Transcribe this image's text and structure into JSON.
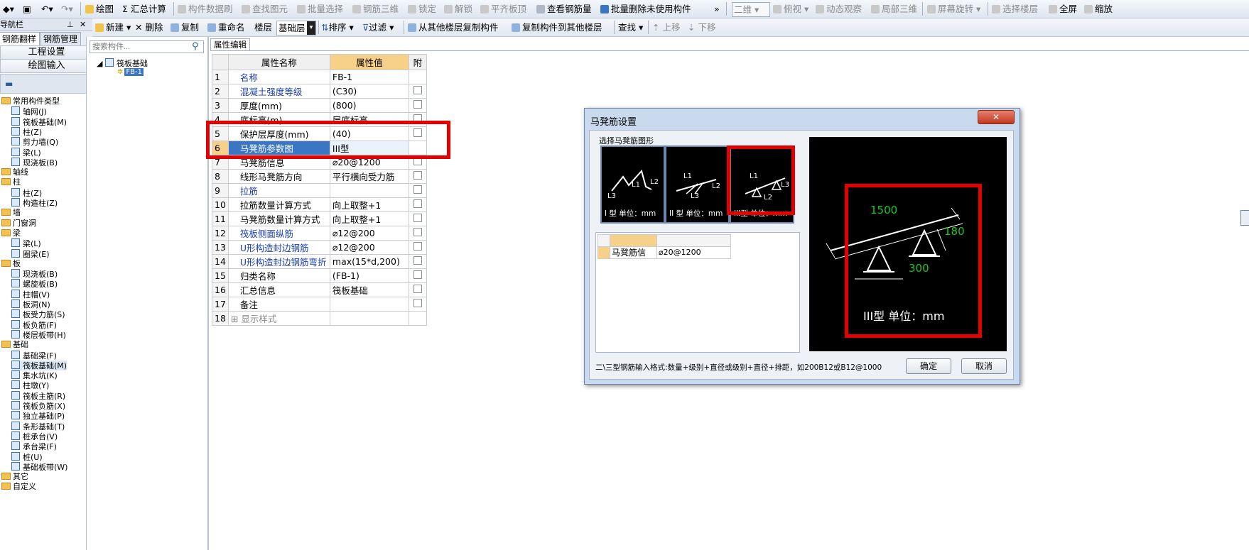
{
  "toolbar": {
    "draw": "绘图",
    "summary": "Σ 汇总计算",
    "brush": "构件数据刷",
    "find_elem": "查找图元",
    "batch_select": "批量选择",
    "rebar_3d": "钢筋三维",
    "lock": "锁定",
    "unlock": "解锁",
    "flat_top": "平齐板顶",
    "view_rebar": "查看钢筋量",
    "batch_delete": "批量删除未使用构件",
    "view_2d": "二维",
    "topview": "俯视",
    "dynamic": "动态观察",
    "local_3d": "局部三维",
    "rotate": "屏幕旋转",
    "select_floor": "选择楼层",
    "fullscreen": "全屏",
    "zoom": "缩放"
  },
  "toolbar2": {
    "new": "新建",
    "delete": "删除",
    "copy": "复制",
    "rename": "重命名",
    "floor_label": "楼层",
    "floor_value": "基础层",
    "sort": "排序",
    "filter": "过滤",
    "copy_from": "从其他楼层复制构件",
    "copy_to": "复制构件到其他楼层",
    "find": "查找",
    "move_up": "上移",
    "move_down": "下移"
  },
  "nav": {
    "header": "导航栏",
    "tab_rebar": "钢筋翻样",
    "tab_manage": "钢筋管理",
    "project_settings": "工程设置",
    "drawing_input": "绘图输入",
    "items": [
      {
        "label": "常用构件类型",
        "folder": true
      },
      {
        "label": "轴网(J)",
        "folder": false
      },
      {
        "label": "筏板基础(M)",
        "folder": false
      },
      {
        "label": "柱(Z)",
        "folder": false
      },
      {
        "label": "剪力墙(Q)",
        "folder": false
      },
      {
        "label": "梁(L)",
        "folder": false
      },
      {
        "label": "现浇板(B)",
        "folder": false
      },
      {
        "label": "轴线",
        "folder": true
      },
      {
        "label": "柱",
        "folder": true
      },
      {
        "label": "柱(Z)",
        "folder": false
      },
      {
        "label": "构造柱(Z)",
        "folder": false
      },
      {
        "label": "墙",
        "folder": true
      },
      {
        "label": "门窗洞",
        "folder": true
      },
      {
        "label": "梁",
        "folder": true
      },
      {
        "label": "梁(L)",
        "folder": false
      },
      {
        "label": "圈梁(E)",
        "folder": false
      },
      {
        "label": "板",
        "folder": true
      },
      {
        "label": "现浇板(B)",
        "folder": false
      },
      {
        "label": "螺旋板(B)",
        "folder": false
      },
      {
        "label": "柱帽(V)",
        "folder": false
      },
      {
        "label": "板洞(N)",
        "folder": false
      },
      {
        "label": "板受力筋(S)",
        "folder": false
      },
      {
        "label": "板负筋(F)",
        "folder": false
      },
      {
        "label": "楼层板带(H)",
        "folder": false
      },
      {
        "label": "基础",
        "folder": true
      },
      {
        "label": "基础梁(F)",
        "folder": false
      },
      {
        "label": "筏板基础(M)",
        "folder": false
      },
      {
        "label": "集水坑(K)",
        "folder": false
      },
      {
        "label": "柱墩(Y)",
        "folder": false
      },
      {
        "label": "筏板主筋(R)",
        "folder": false
      },
      {
        "label": "筏板负筋(X)",
        "folder": false
      },
      {
        "label": "独立基础(P)",
        "folder": false
      },
      {
        "label": "条形基础(T)",
        "folder": false
      },
      {
        "label": "桩承台(V)",
        "folder": false
      },
      {
        "label": "承台梁(F)",
        "folder": false
      },
      {
        "label": "桩(U)",
        "folder": false
      },
      {
        "label": "基础板带(W)",
        "folder": false
      },
      {
        "label": "其它",
        "folder": true
      },
      {
        "label": "自定义",
        "folder": true
      }
    ]
  },
  "tree": {
    "search_placeholder": "搜索构件...",
    "root": "筏板基础",
    "child": "FB-1"
  },
  "grid": {
    "tab": "属性编辑",
    "col_name": "属性名称",
    "col_value": "属性值",
    "col_extra": "附",
    "rows": [
      {
        "n": "1",
        "name": "名称",
        "value": "FB-1",
        "link": true,
        "cb": false
      },
      {
        "n": "2",
        "name": "混凝土强度等级",
        "value": "(C30)",
        "link": true,
        "cb": true
      },
      {
        "n": "3",
        "name": "厚度(mm)",
        "value": "(800)",
        "link": false,
        "cb": true
      },
      {
        "n": "4",
        "name": "底标高(m)",
        "value": "层底标高",
        "link": false,
        "cb": true
      },
      {
        "n": "5",
        "name": "保护层厚度(mm)",
        "value": "(40)",
        "link": false,
        "cb": true
      },
      {
        "n": "6",
        "name": "马凳筋参数图",
        "value": "III型",
        "link": true,
        "cb": false
      },
      {
        "n": "7",
        "name": "马凳筋信息",
        "value": "⌀20@1200",
        "link": false,
        "cb": true
      },
      {
        "n": "8",
        "name": "线形马凳筋方向",
        "value": "平行横向受力筋",
        "link": false,
        "cb": true
      },
      {
        "n": "9",
        "name": "拉筋",
        "value": "",
        "link": true,
        "cb": true
      },
      {
        "n": "10",
        "name": "拉筋数量计算方式",
        "value": "向上取整+1",
        "link": false,
        "cb": true
      },
      {
        "n": "11",
        "name": "马凳筋数量计算方式",
        "value": "向上取整+1",
        "link": false,
        "cb": true
      },
      {
        "n": "12",
        "name": "筏板侧面纵筋",
        "value": "⌀12@200",
        "link": true,
        "cb": true
      },
      {
        "n": "13",
        "name": "U形构造封边钢筋",
        "value": "⌀12@200",
        "link": true,
        "cb": true
      },
      {
        "n": "14",
        "name": "U形构造封边钢筋弯折",
        "value": "max(15*d,200)",
        "link": true,
        "cb": true
      },
      {
        "n": "15",
        "name": "归类名称",
        "value": "(FB-1)",
        "link": false,
        "cb": true
      },
      {
        "n": "16",
        "name": "汇总信息",
        "value": "筏板基础",
        "link": false,
        "cb": true
      },
      {
        "n": "17",
        "name": "备注",
        "value": "",
        "link": false,
        "cb": true
      },
      {
        "n": "18",
        "name": "显示样式",
        "value": "",
        "link": false,
        "cb": false
      }
    ]
  },
  "dialog": {
    "title": "马凳筋设置",
    "close": "✕",
    "group_label": "选择马凳筋图形",
    "type1_caption": "I 型  单位：mm",
    "type2_caption": "II 型  单位：mm",
    "type3_caption": "III型  单位：mm",
    "info_label": "马凳筋信",
    "info_value": "⌀20@1200",
    "dim_1500": "1500",
    "dim_180": "180",
    "dim_300": "300",
    "big_caption": "III型  单位：mm",
    "hint": "二\\三型钢筋输入格式:数量+级别+直径或级别+直径+排距，如200B12或B12@1000",
    "ok": "确定",
    "cancel": "取消",
    "L1": "L1",
    "L2": "L2",
    "L3": "L3"
  }
}
